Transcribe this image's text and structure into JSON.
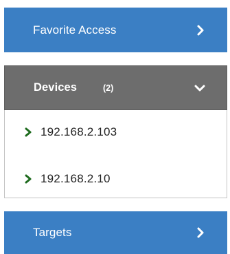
{
  "panels": {
    "favorite": {
      "label": "Favorite Access",
      "icon": "chevron-right-icon",
      "color": "#3b7fc4",
      "expanded": false
    },
    "devices": {
      "label": "Devices",
      "count": "(2)",
      "icon": "chevron-down-icon",
      "color": "#6d6d6d",
      "expanded": true,
      "items": [
        {
          "label": "192.168.2.103",
          "icon": "chevron-right-icon",
          "icon_color": "#1e6b1e"
        },
        {
          "label": "192.168.2.10",
          "icon": "chevron-right-icon",
          "icon_color": "#1e6b1e"
        }
      ]
    },
    "targets": {
      "label": "Targets",
      "icon": "chevron-right-icon",
      "color": "#3b7fc4",
      "expanded": false
    }
  }
}
